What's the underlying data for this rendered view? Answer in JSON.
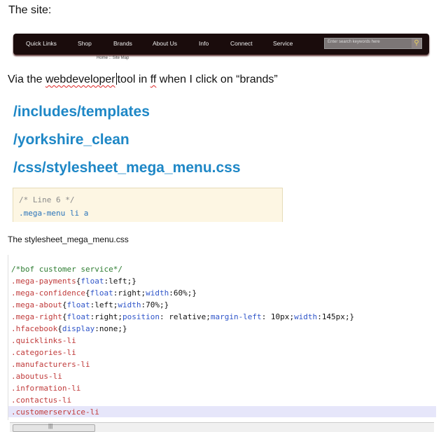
{
  "captions": {
    "site": "The site:",
    "via_before": "Via the ",
    "via_word1": "webdeveloper",
    "via_middle": "tool in ",
    "via_word2": "ff",
    "via_after": " when I click on “brands”",
    "stylesheet": "The stylesheet_mega_menu.css"
  },
  "site_nav": {
    "items": [
      "Quick Links",
      "Shop",
      "Brands",
      "About Us",
      "Info",
      "Connect",
      "Service"
    ],
    "search_placeholder": "Enter search keywords here",
    "search_icon": "magnifier-icon",
    "breadcrumb": "Home :: Site Map"
  },
  "paths": [
    "/includes/templates",
    "/yorkshire_clean",
    "/css/stylesheet_mega_menu.css"
  ],
  "inspector_box": {
    "comment": "/* Line 6 */",
    "selector": ".mega-menu li a"
  },
  "code": {
    "comment": "/*bof customer service*/",
    "lines": [
      {
        "sel": ".mega-payments",
        "open": "{",
        "decl": [
          {
            "p": "float",
            "v": "left"
          }
        ],
        "close": ";}"
      },
      {
        "sel": ".mega-confidence",
        "open": "{",
        "decl": [
          {
            "p": "float",
            "v": "right"
          },
          {
            "p": "width",
            "v": "60%"
          }
        ],
        "close": ";}"
      },
      {
        "sel": ".mega-about",
        "open": "{",
        "decl": [
          {
            "p": "float",
            "v": "left"
          },
          {
            "p": "width",
            "v": "70%"
          }
        ],
        "close": ";}"
      },
      {
        "sel": ".mega-right",
        "open": "{",
        "decl": [
          {
            "p": "float",
            "v": "right"
          },
          {
            "p": "position",
            "v": " relative"
          },
          {
            "p": "margin-left",
            "v": " 10px"
          },
          {
            "p": "width",
            "v": "145px"
          }
        ],
        "close": ";}"
      },
      {
        "sel": ".hfacebook",
        "open": "{",
        "decl": [
          {
            "p": "display",
            "v": "none"
          }
        ],
        "close": ";}"
      }
    ],
    "selectors": [
      ".quicklinks-li",
      ".categories-li",
      ".manufacturers-li",
      ".aboutus-li",
      ".information-li",
      ".contactus-li",
      ".customerservice-li"
    ],
    "highlighted_selector": ".customerservice-li"
  },
  "scrollbar_grip": "|||"
}
